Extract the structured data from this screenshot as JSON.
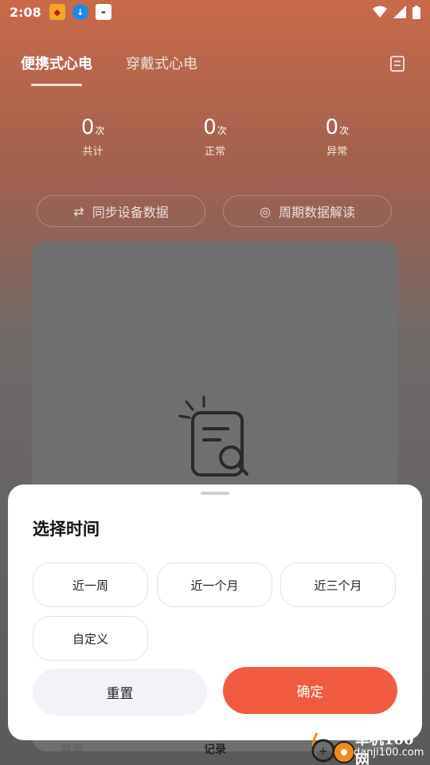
{
  "status_bar": {
    "time": "2:08",
    "app_icon_1": "app1-icon",
    "app_icon_2": "download-icon",
    "app_icon_3": "app3-icon"
  },
  "tabs": [
    {
      "label": "便携式心电",
      "active": true
    },
    {
      "label": "穿戴式心电",
      "active": false
    }
  ],
  "stats": [
    {
      "value": "0",
      "unit": "次",
      "label": "共计"
    },
    {
      "value": "0",
      "unit": "次",
      "label": "正常"
    },
    {
      "value": "0",
      "unit": "次",
      "label": "异常"
    }
  ],
  "actions": {
    "sync_label": "同步设备数据",
    "interpret_label": "周期数据解读"
  },
  "bottom_nav": {
    "monitor_label": "监测",
    "record_label": "记录"
  },
  "sheet": {
    "title": "选择时间",
    "options": [
      "近一周",
      "近一个月",
      "近三个月",
      "自定义"
    ],
    "reset_label": "重置",
    "confirm_label": "确定"
  },
  "watermark": {
    "name": "单机100网",
    "url": "danji100.com"
  },
  "colors": {
    "accent": "#f05a3e",
    "sheet_bg": "#ffffff",
    "reset_bg": "#f2f2f7"
  }
}
